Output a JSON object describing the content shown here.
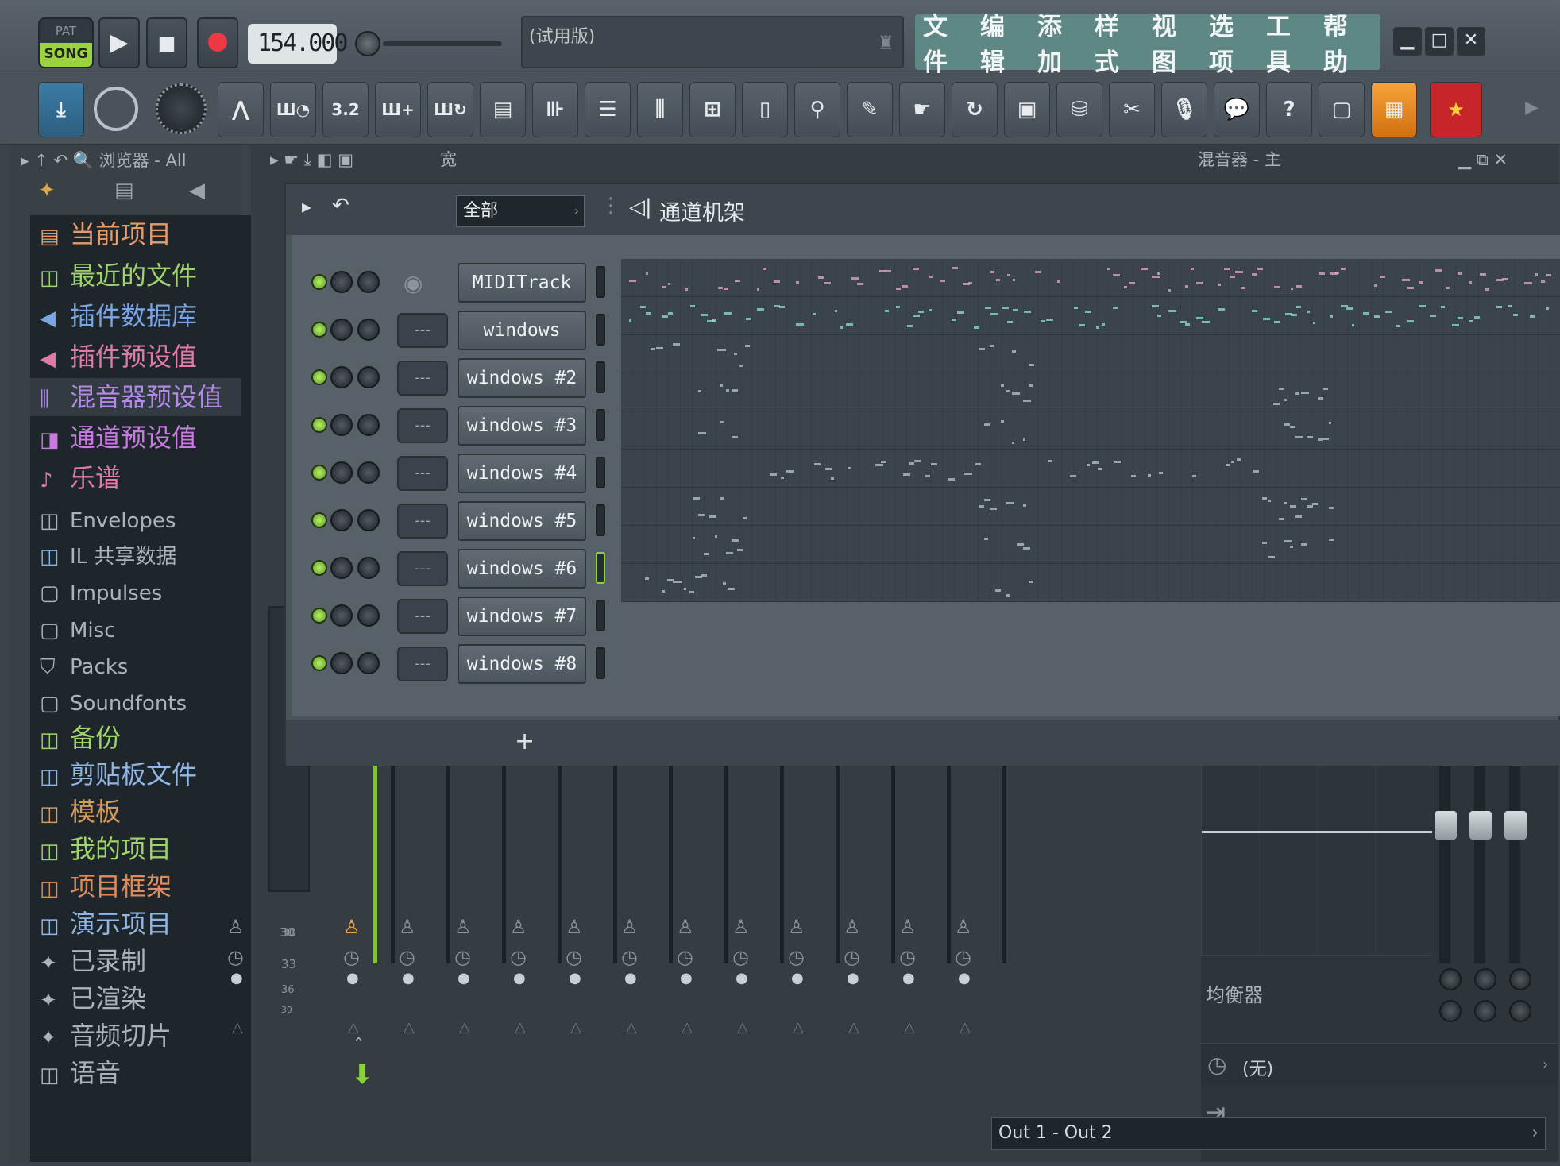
{
  "transport": {
    "pat_label": "PAT",
    "song_label": "SONG",
    "tempo": "154.000",
    "hint": "(试用版)"
  },
  "menu": [
    "文件",
    "编辑",
    "添加",
    "样式",
    "视图",
    "选项",
    "工具",
    "帮助"
  ],
  "toolbar": {
    "count_label": "3.2",
    "accent_color": "#f39a2e"
  },
  "browser": {
    "title": "浏览器 - All",
    "items": [
      {
        "label": "当前项目",
        "icon": "file-icon",
        "color": "#e89a6a"
      },
      {
        "label": "最近的文件",
        "icon": "folder-link-icon",
        "color": "#9fd46a"
      },
      {
        "label": "插件数据库",
        "icon": "speaker-icon",
        "color": "#7aa6e8"
      },
      {
        "label": "插件预设值",
        "icon": "speaker-icon",
        "color": "#e07aa6"
      },
      {
        "label": "混音器预设值",
        "icon": "mixer-icon",
        "color": "#b38ae8"
      },
      {
        "label": "通道预设值",
        "icon": "channel-icon",
        "color": "#c87ae0"
      },
      {
        "label": "乐谱",
        "icon": "note-icon",
        "color": "#e07aa6"
      },
      {
        "label": "Envelopes",
        "icon": "folder-link-icon",
        "color": "#aab3ba"
      },
      {
        "label": "IL 共享数据",
        "icon": "folder-link-icon",
        "color": "#7ab3e8"
      },
      {
        "label": "Impulses",
        "icon": "folder-icon",
        "color": "#aab3ba"
      },
      {
        "label": "Misc",
        "icon": "folder-icon",
        "color": "#aab3ba"
      },
      {
        "label": "Packs",
        "icon": "packs-icon",
        "color": "#aab3ba"
      },
      {
        "label": "Soundfonts",
        "icon": "folder-icon",
        "color": "#aab3ba"
      },
      {
        "label": "备份",
        "icon": "folder-link-icon",
        "color": "#9fd46a"
      },
      {
        "label": "剪贴板文件",
        "icon": "folder-link-icon",
        "color": "#8fb6e6"
      },
      {
        "label": "模板",
        "icon": "folder-link-icon",
        "color": "#d49a5a"
      },
      {
        "label": "我的项目",
        "icon": "folder-link-icon",
        "color": "#9fd46a"
      },
      {
        "label": "项目框架",
        "icon": "folder-link-icon",
        "color": "#e08c5a"
      },
      {
        "label": "演示项目",
        "icon": "folder-link-icon",
        "color": "#8fb6e6"
      },
      {
        "label": "已录制",
        "icon": "waveform-icon",
        "color": "#aab3ba"
      },
      {
        "label": "已渲染",
        "icon": "waveform-icon",
        "color": "#aab3ba"
      },
      {
        "label": "音频切片",
        "icon": "waveform-icon",
        "color": "#aab3ba"
      },
      {
        "label": "语音",
        "icon": "folder-link-icon",
        "color": "#aab3ba"
      }
    ]
  },
  "mixer": {
    "header_wide": "宽",
    "title": "混音器 - 主",
    "eq_label": "均衡器",
    "none_label": "(无)",
    "output": "Out 1 - Out 2",
    "db_marks": [
      "30",
      "33",
      "36",
      "39"
    ]
  },
  "rack": {
    "filter": "全部",
    "title": "通道机架",
    "add_label": "+",
    "channels": [
      {
        "name": "MIDITrack",
        "mixer": ""
      },
      {
        "name": "windows",
        "mixer": "---"
      },
      {
        "name": "windows #2",
        "mixer": "---"
      },
      {
        "name": "windows #3",
        "mixer": "---"
      },
      {
        "name": "windows #4",
        "mixer": "---"
      },
      {
        "name": "windows #5",
        "mixer": "---"
      },
      {
        "name": "windows #6",
        "mixer": "---"
      },
      {
        "name": "windows #7",
        "mixer": "---"
      },
      {
        "name": "windows #8",
        "mixer": "---"
      }
    ]
  }
}
